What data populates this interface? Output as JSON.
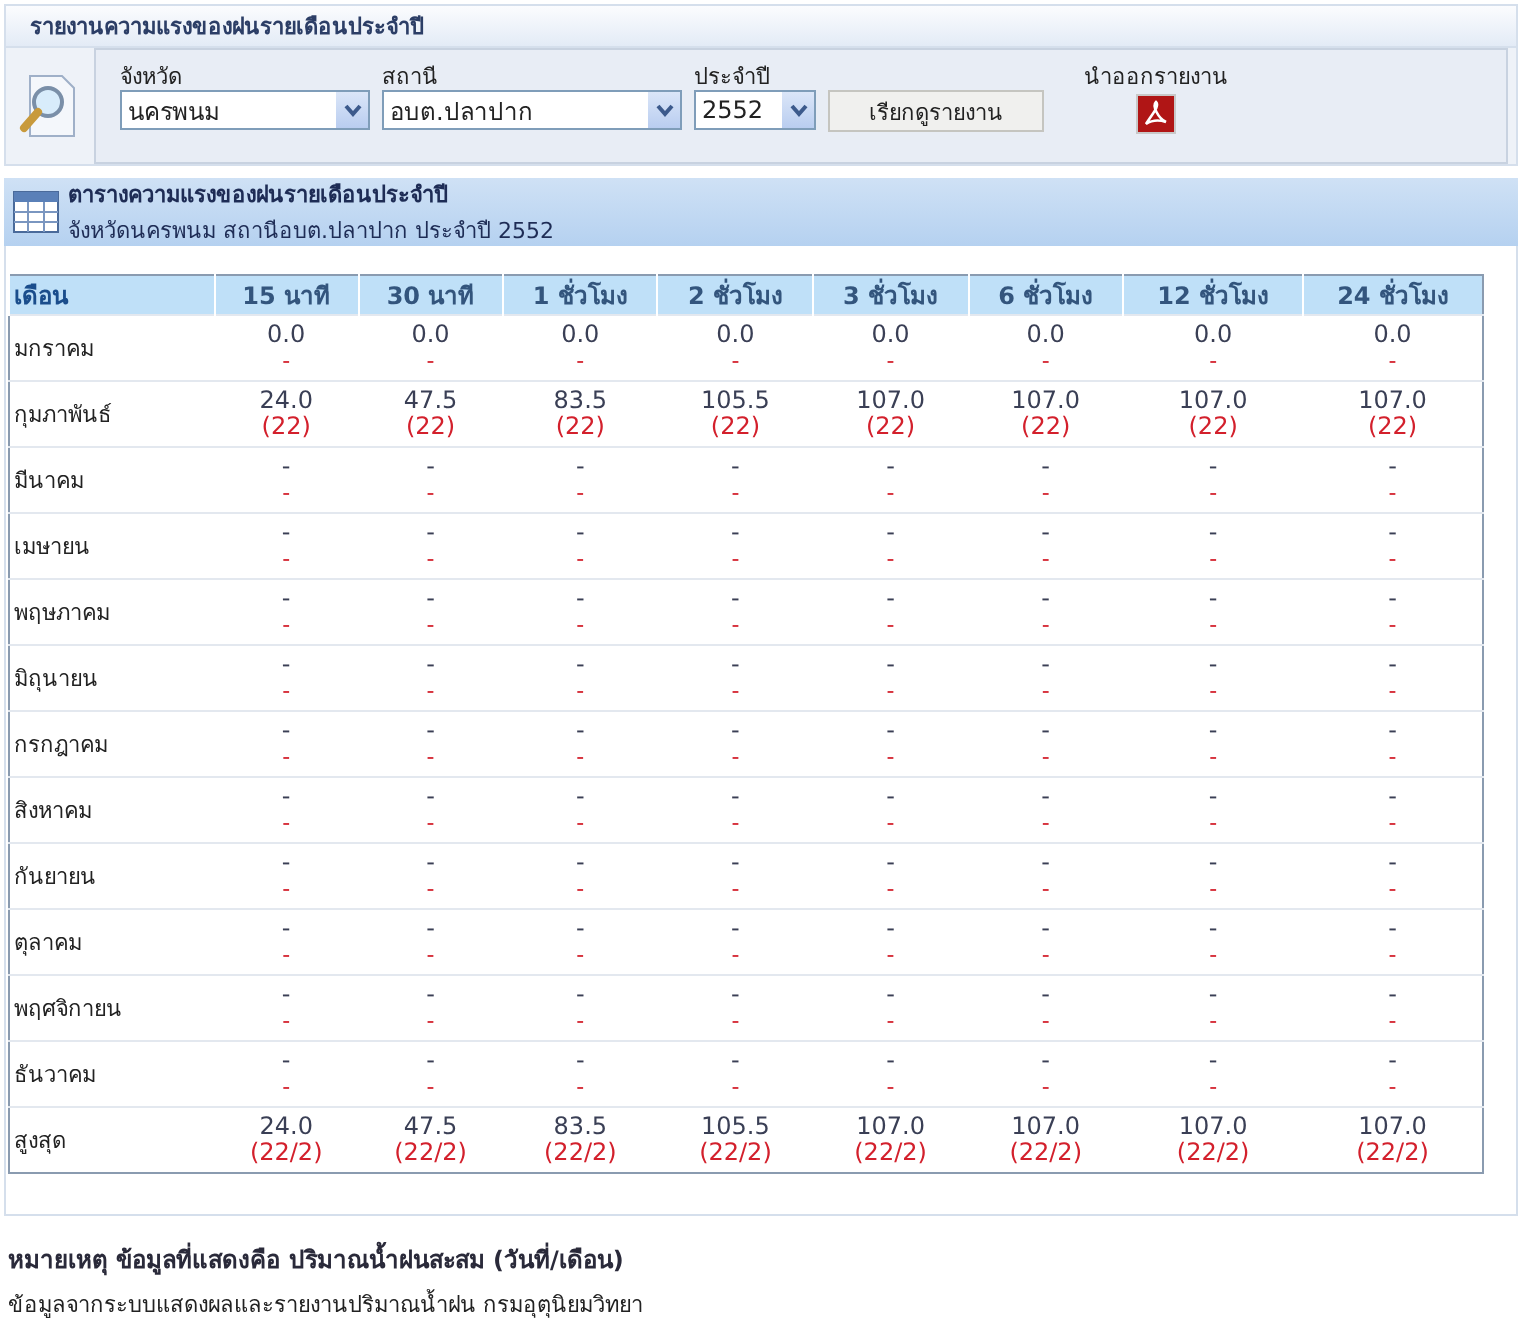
{
  "page_title": "รายงานความแรงของฝนรายเดือนประจำปี",
  "filters": {
    "province": {
      "label": "จังหวัด",
      "value": "นครพนม"
    },
    "station": {
      "label": "สถานี",
      "value": "อบต.ปลาปาก"
    },
    "year": {
      "label": "ประจำปี",
      "value": "2552"
    },
    "submit": "เรียกดูรายงาน",
    "export_label": "นำออกรายงาน"
  },
  "report_header": {
    "title": "ตารางความแรงของฝนรายเดือนประจำปี",
    "subtitle": "จังหวัดนครพนม สถานีอบต.ปลาปาก ประจำปี 2552"
  },
  "table": {
    "columns": [
      "เดือน",
      "15 นาที",
      "30 นาที",
      "1 ชั่วโมง",
      "2 ชั่วโมง",
      "3 ชั่วโมง",
      "6 ชั่วโมง",
      "12 ชั่วโมง",
      "24 ชั่วโมง"
    ],
    "rows": [
      {
        "month": "มกราคม",
        "values": [
          "0.0",
          "0.0",
          "0.0",
          "0.0",
          "0.0",
          "0.0",
          "0.0",
          "0.0"
        ],
        "notes": [
          "-",
          "-",
          "-",
          "-",
          "-",
          "-",
          "-",
          "-"
        ]
      },
      {
        "month": "กุมภาพันธ์",
        "values": [
          "24.0",
          "47.5",
          "83.5",
          "105.5",
          "107.0",
          "107.0",
          "107.0",
          "107.0"
        ],
        "notes": [
          "(22)",
          "(22)",
          "(22)",
          "(22)",
          "(22)",
          "(22)",
          "(22)",
          "(22)"
        ]
      },
      {
        "month": "มีนาคม",
        "values": [
          "-",
          "-",
          "-",
          "-",
          "-",
          "-",
          "-",
          "-"
        ],
        "notes": [
          "-",
          "-",
          "-",
          "-",
          "-",
          "-",
          "-",
          "-"
        ]
      },
      {
        "month": "เมษายน",
        "values": [
          "-",
          "-",
          "-",
          "-",
          "-",
          "-",
          "-",
          "-"
        ],
        "notes": [
          "-",
          "-",
          "-",
          "-",
          "-",
          "-",
          "-",
          "-"
        ]
      },
      {
        "month": "พฤษภาคม",
        "values": [
          "-",
          "-",
          "-",
          "-",
          "-",
          "-",
          "-",
          "-"
        ],
        "notes": [
          "-",
          "-",
          "-",
          "-",
          "-",
          "-",
          "-",
          "-"
        ]
      },
      {
        "month": "มิถุนายน",
        "values": [
          "-",
          "-",
          "-",
          "-",
          "-",
          "-",
          "-",
          "-"
        ],
        "notes": [
          "-",
          "-",
          "-",
          "-",
          "-",
          "-",
          "-",
          "-"
        ]
      },
      {
        "month": "กรกฎาคม",
        "values": [
          "-",
          "-",
          "-",
          "-",
          "-",
          "-",
          "-",
          "-"
        ],
        "notes": [
          "-",
          "-",
          "-",
          "-",
          "-",
          "-",
          "-",
          "-"
        ]
      },
      {
        "month": "สิงหาคม",
        "values": [
          "-",
          "-",
          "-",
          "-",
          "-",
          "-",
          "-",
          "-"
        ],
        "notes": [
          "-",
          "-",
          "-",
          "-",
          "-",
          "-",
          "-",
          "-"
        ]
      },
      {
        "month": "กันยายน",
        "values": [
          "-",
          "-",
          "-",
          "-",
          "-",
          "-",
          "-",
          "-"
        ],
        "notes": [
          "-",
          "-",
          "-",
          "-",
          "-",
          "-",
          "-",
          "-"
        ]
      },
      {
        "month": "ตุลาคม",
        "values": [
          "-",
          "-",
          "-",
          "-",
          "-",
          "-",
          "-",
          "-"
        ],
        "notes": [
          "-",
          "-",
          "-",
          "-",
          "-",
          "-",
          "-",
          "-"
        ]
      },
      {
        "month": "พฤศจิกายน",
        "values": [
          "-",
          "-",
          "-",
          "-",
          "-",
          "-",
          "-",
          "-"
        ],
        "notes": [
          "-",
          "-",
          "-",
          "-",
          "-",
          "-",
          "-",
          "-"
        ]
      },
      {
        "month": "ธันวาคม",
        "values": [
          "-",
          "-",
          "-",
          "-",
          "-",
          "-",
          "-",
          "-"
        ],
        "notes": [
          "-",
          "-",
          "-",
          "-",
          "-",
          "-",
          "-",
          "-"
        ]
      },
      {
        "month": "สูงสุด",
        "values": [
          "24.0",
          "47.5",
          "83.5",
          "105.5",
          "107.0",
          "107.0",
          "107.0",
          "107.0"
        ],
        "notes": [
          "(22/2)",
          "(22/2)",
          "(22/2)",
          "(22/2)",
          "(22/2)",
          "(22/2)",
          "(22/2)",
          "(22/2)"
        ]
      }
    ]
  },
  "footnote": {
    "title": "หมายเหตุ ข้อมูลที่แสดงคือ ปริมาณน้ำฝนสะสม (วันที่/เดือน)",
    "source": "ข้อมูลจากระบบแสดงผลและรายงานปริมาณน้ำฝน กรมอุตุนิยมวิทยา"
  }
}
